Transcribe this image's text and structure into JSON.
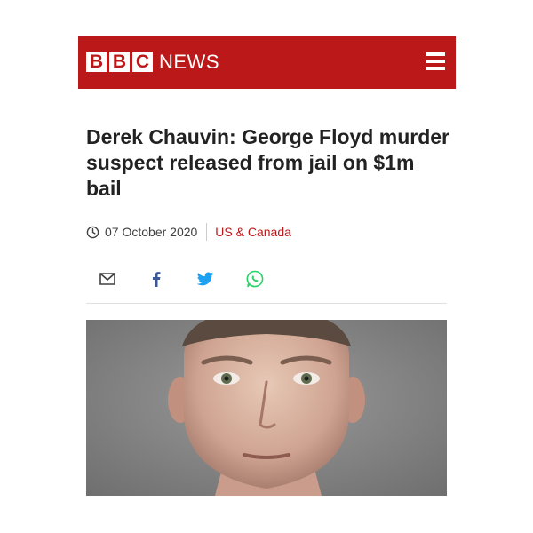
{
  "header": {
    "logo_letters": [
      "B",
      "B",
      "C"
    ],
    "logo_suffix": "NEWS",
    "menu_icon": "hamburger-menu-icon",
    "brand_color": "#bb1919"
  },
  "article": {
    "headline": "Derek Chauvin: George Floyd murder suspect released from jail on $1m bail",
    "date": "07 October 2020",
    "section": "US & Canada",
    "section_color": "#bb1919",
    "share_icons": [
      "email-icon",
      "facebook-icon",
      "twitter-icon",
      "whatsapp-icon"
    ],
    "photo": "mugshot-photo"
  }
}
